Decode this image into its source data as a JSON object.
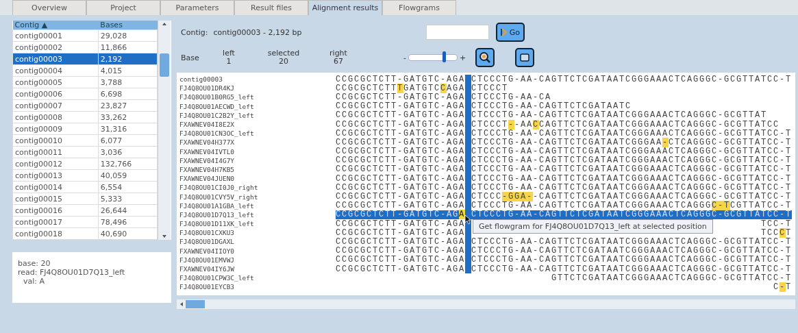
{
  "tabs": [
    {
      "label": "Overview",
      "selected": false
    },
    {
      "label": "Project",
      "selected": false
    },
    {
      "label": "Parameters",
      "selected": false
    },
    {
      "label": "Result files",
      "selected": false
    },
    {
      "label": "Alignment results",
      "selected": true
    },
    {
      "label": "Flowgrams",
      "selected": false
    }
  ],
  "contig_table": {
    "columns": [
      "Contig ▲",
      "Bases"
    ],
    "rows": [
      {
        "contig": "contig00001",
        "bases": "29,028",
        "selected": false
      },
      {
        "contig": "contig00002",
        "bases": "11,866",
        "selected": false
      },
      {
        "contig": "contig00003",
        "bases": "2,192",
        "selected": true
      },
      {
        "contig": "contig00004",
        "bases": "4,015",
        "selected": false
      },
      {
        "contig": "contig00005",
        "bases": "3,788",
        "selected": false
      },
      {
        "contig": "contig00006",
        "bases": "6,698",
        "selected": false
      },
      {
        "contig": "contig00007",
        "bases": "23,827",
        "selected": false
      },
      {
        "contig": "contig00008",
        "bases": "33,262",
        "selected": false
      },
      {
        "contig": "contig00009",
        "bases": "31,316",
        "selected": false
      },
      {
        "contig": "contig00010",
        "bases": "6,077",
        "selected": false
      },
      {
        "contig": "contig00011",
        "bases": "3,036",
        "selected": false
      },
      {
        "contig": "contig00012",
        "bases": "132,766",
        "selected": false
      },
      {
        "contig": "contig00013",
        "bases": "40,059",
        "selected": false
      },
      {
        "contig": "contig00014",
        "bases": "6,554",
        "selected": false
      },
      {
        "contig": "contig00015",
        "bases": "5,333",
        "selected": false
      },
      {
        "contig": "contig00016",
        "bases": "26,644",
        "selected": false
      },
      {
        "contig": "contig00017",
        "bases": "78,496",
        "selected": false
      },
      {
        "contig": "contig00018",
        "bases": "40,690",
        "selected": false
      }
    ]
  },
  "info": [
    "base: 20",
    "read: FJ4Q8OU01D7Q13_left",
    "val: A"
  ],
  "header": {
    "contig_label": "Contig:",
    "contig_value": "contig00003 - 2,192 bp",
    "go_button": "Go",
    "base_label": "Base",
    "positions": [
      {
        "label": "left",
        "value": "1"
      },
      {
        "label": "selected",
        "value": "20"
      },
      {
        "label": "right",
        "value": "67"
      }
    ],
    "zoom_slider": {
      "minus": "-",
      "plus": "+",
      "level": 0.75
    }
  },
  "alignment": {
    "tooltip": "Get flowgram for FJ4Q8OU01D7Q13_left at selected position",
    "rows": [
      {
        "name": "contig00003",
        "selected": false,
        "in_column": true,
        "left": [
          {
            "text": "CCGCGCTCTT-GATGTC-AGA",
            "highlighted": false
          }
        ],
        "right": [
          {
            "text": "CTCCCTG-AA-CAGTTCTCGATAATCGGGAAACTCAGGGC-GCGTTATCC-T",
            "highlighted": false
          }
        ]
      },
      {
        "name": "FJ4Q8OU01DR4KJ",
        "selected": false,
        "in_column": true,
        "left": [
          {
            "text": "CCGCGCTCTT",
            "highlighted": false
          },
          {
            "text": "T",
            "highlighted": true
          },
          {
            "text": "GATGTC",
            "highlighted": false
          },
          {
            "text": "C",
            "highlighted": true
          },
          {
            "text": "AGA",
            "highlighted": false
          }
        ],
        "right": [
          {
            "text": "CTCCCT",
            "highlighted": false
          }
        ]
      },
      {
        "name": "FJ4Q8OU01B0RG5_left",
        "selected": false,
        "in_column": true,
        "left": [
          {
            "text": "CCGCGCTCTT-GATGTC-AGA",
            "highlighted": false
          }
        ],
        "right": [
          {
            "text": "CTCCCTG-AA-CA",
            "highlighted": false
          }
        ]
      },
      {
        "name": "FJ4Q8OU01AECWD_left",
        "selected": false,
        "in_column": true,
        "left": [
          {
            "text": "CCGCGCTCTT-GATGTC-AGA",
            "highlighted": false
          }
        ],
        "right": [
          {
            "text": "CTCCCTG-AA-CAGTTCTCGATAATC",
            "highlighted": false
          }
        ]
      },
      {
        "name": "FJ4Q8OU01C2B2Y_left",
        "selected": false,
        "in_column": true,
        "left": [
          {
            "text": "CCGCGCTCTT-GATGTC-AGA",
            "highlighted": false
          }
        ],
        "right": [
          {
            "text": "CTCCCTG-AA-CAGTTCTCGATAATCGGGAAACTCAGGGC-GCGTTAT",
            "highlighted": false
          }
        ]
      },
      {
        "name": "FXAWNEV04I8E2X",
        "selected": false,
        "in_column": true,
        "left": [
          {
            "text": "CCGCGCTCTT-GATGTC-AGA",
            "highlighted": false
          }
        ],
        "right": [
          {
            "text": "CTCCCT",
            "highlighted": false
          },
          {
            "text": "-",
            "highlighted": true
          },
          {
            "text": "-AA",
            "highlighted": false
          },
          {
            "text": "C",
            "highlighted": true
          },
          {
            "text": "CAGTTCTCGATAATCGGGAAACTCAGGGC-GCGTTATCC",
            "highlighted": false
          }
        ]
      },
      {
        "name": "FJ4Q8OU01CN3OC_left",
        "selected": false,
        "in_column": true,
        "left": [
          {
            "text": "CCGCGCTCTT-GATGTC-AGA",
            "highlighted": false
          }
        ],
        "right": [
          {
            "text": "CTCCCTG-AA-CAGTTCTCGATAATCGGGAAACTCAGGGC-GCGTTATCC-T",
            "highlighted": false
          }
        ]
      },
      {
        "name": "FXAWNEV04H377X",
        "selected": false,
        "in_column": true,
        "left": [
          {
            "text": "CCGCGCTCTT-GATGTC-AGA",
            "highlighted": false
          }
        ],
        "right": [
          {
            "text": "CTCCCTG-AA-CAGTTCTCGATAATCGGGAA",
            "highlighted": false
          },
          {
            "text": "-",
            "highlighted": true
          },
          {
            "text": "CTCAGGGC-GCGTTATCC-T",
            "highlighted": false
          }
        ]
      },
      {
        "name": "FXAWNEV04IVTL0",
        "selected": false,
        "in_column": true,
        "left": [
          {
            "text": "CCGCGCTCTT-GATGTC-AGA",
            "highlighted": false
          }
        ],
        "right": [
          {
            "text": "CTCCCTG-AA-CAGTTCTCGATAATCGGGAAACTCAGGGC-GCGTTATCC-T",
            "highlighted": false
          }
        ]
      },
      {
        "name": "FXAWNEV04I4G7Y",
        "selected": false,
        "in_column": true,
        "left": [
          {
            "text": "CCGCGCTCTT-GATGTC-AGA",
            "highlighted": false
          }
        ],
        "right": [
          {
            "text": "CTCCCTG-AA-CAGTTCTCGATAATCGGGAAACTCAGGGC-GCGTTATCC-T",
            "highlighted": false
          }
        ]
      },
      {
        "name": "FXAWNEV04H7KB5",
        "selected": false,
        "in_column": true,
        "left": [
          {
            "text": "CCGCGCTCTT-GATGTC-AGA",
            "highlighted": false
          }
        ],
        "right": [
          {
            "text": "CTCCCTG-AA-CAGTTCTCGATAATCGGGAAACTCAGGGC-GCGTTATCC-T",
            "highlighted": false
          }
        ]
      },
      {
        "name": "FXAWNEV04JUEN0",
        "selected": false,
        "in_column": true,
        "left": [
          {
            "text": "CCGCGCTCTT-GATGTC-AGA",
            "highlighted": false
          }
        ],
        "right": [
          {
            "text": "CTCCCTG-AA-CAGTTCTCGATAATCGGGAAACTCAGGGC-GCGTTATCC-T",
            "highlighted": false
          }
        ]
      },
      {
        "name": "FJ4Q8OU01CI0J0_right",
        "selected": false,
        "in_column": true,
        "left": [
          {
            "text": "CCGCGCTCTT-GATGTC-AGA",
            "highlighted": false
          }
        ],
        "right": [
          {
            "text": "CTCCCTG-AA-CAGTTCTCGATAATCGGGAAACTCAGGGC-GCGTTATCC-T",
            "highlighted": false
          }
        ]
      },
      {
        "name": "FJ4Q8OU01CVY5V_right",
        "selected": false,
        "in_column": true,
        "left": [
          {
            "text": "CCGCGCTCTT-GATGTC-AGA",
            "highlighted": false
          }
        ],
        "right": [
          {
            "text": "CTCCC",
            "highlighted": false
          },
          {
            "text": "-GGA-",
            "highlighted": true
          },
          {
            "text": "-CAGTTCTCGATAATCGGGAAACTCAGGGC-GCGTTATCC-T",
            "highlighted": false
          }
        ]
      },
      {
        "name": "FJ4Q8OU01A1GBA_left",
        "selected": false,
        "in_column": true,
        "left": [
          {
            "text": "CCGCGCTCTT-GATGTC-AGA",
            "highlighted": false
          }
        ],
        "right": [
          {
            "text": "CTCCCTG-AA-CAGTTCTCGATAATCGGGAAACTCAGGG",
            "highlighted": false
          },
          {
            "text": "C-T",
            "highlighted": true
          },
          {
            "text": "CGTTATCC-T",
            "highlighted": false
          }
        ]
      },
      {
        "name": "FJ4Q8OU01D7Q13_left",
        "selected": true,
        "in_column": true,
        "left": [
          {
            "text": "CCGCGCTCTT-GATGTC-AG",
            "highlighted": false
          },
          {
            "text": "A",
            "highlighted": true
          }
        ],
        "right": [
          {
            "text": "CTCCCTG-AA-CAGTTCTCGATAATCGGGAAACTCAGGGC-GCGTTATCC-T",
            "highlighted": false
          }
        ]
      },
      {
        "name": "FJ4Q8OU01D11XK_left",
        "selected": false,
        "in_column": true,
        "left": [
          {
            "text": "CCGCGCTCTT-GATGTC-AGA",
            "highlighted": false
          }
        ],
        "right": [
          {
            "text": "                                               TCC-T",
            "highlighted": false
          }
        ]
      },
      {
        "name": "FJ4Q8OU01CXKU3",
        "selected": false,
        "in_column": true,
        "left": [
          {
            "text": "CCGCGCTCTT-GATGTC-AGA",
            "highlighted": false
          }
        ],
        "right": [
          {
            "text": "                                               TCC",
            "highlighted": false
          },
          {
            "text": "C",
            "highlighted": true
          },
          {
            "text": "T",
            "highlighted": false
          }
        ]
      },
      {
        "name": "FJ4Q8OU01DGAXL",
        "selected": false,
        "in_column": true,
        "left": [
          {
            "text": "CCGCGCTCTT-GATGTC-AGA",
            "highlighted": false
          }
        ],
        "right": [
          {
            "text": "CTCCCTG-AA-CAGTTCTCGATAATCGGGAAACTCAGGGC-GCGTTATCC-T",
            "highlighted": false
          }
        ]
      },
      {
        "name": "FXAWNEV04IIOY0",
        "selected": false,
        "in_column": true,
        "left": [
          {
            "text": "CCGCGCTCTT-GATGTC-AGA",
            "highlighted": false
          }
        ],
        "right": [
          {
            "text": "CTCCCTG-AA-CAGTTCTCGATAATCGGGAAACTCAGGGC-GCGTTATCC-T",
            "highlighted": false
          }
        ]
      },
      {
        "name": "FJ4Q8OU01EMVWJ",
        "selected": false,
        "in_column": true,
        "left": [
          {
            "text": "CCGCGCTCTT-GATGTC-AGA",
            "highlighted": false
          }
        ],
        "right": [
          {
            "text": "CTCCCTG-AA-CAGTTCTCGATAATCGGGAAACTCAGGGC-GCGTTATCC-T",
            "highlighted": false
          }
        ]
      },
      {
        "name": "FXAWNEV04IY6JW",
        "selected": false,
        "in_column": true,
        "left": [
          {
            "text": "CCGCGCTCTT-GATGTC-AGA",
            "highlighted": false
          }
        ],
        "right": [
          {
            "text": "CTCCCTG-AA-CAGTTCTCGATAATCGGGAAACTCAGGGC-GCGTTATCC-T",
            "highlighted": false
          }
        ]
      },
      {
        "name": "FJ4Q8OU01CPW3C_left",
        "selected": false,
        "in_column": false,
        "left": [],
        "right": [
          {
            "text": "             GTTCTCGATAATCGGGAAACTCAGGGC-GCGTTATCC-T",
            "highlighted": false
          }
        ]
      },
      {
        "name": "FJ4Q8OU01EYCB3",
        "selected": false,
        "in_column": false,
        "left": [],
        "right": [
          {
            "text": "                                                 C",
            "highlighted": false
          },
          {
            "text": "-",
            "highlighted": true
          },
          {
            "text": "T",
            "highlighted": false
          }
        ]
      }
    ]
  }
}
